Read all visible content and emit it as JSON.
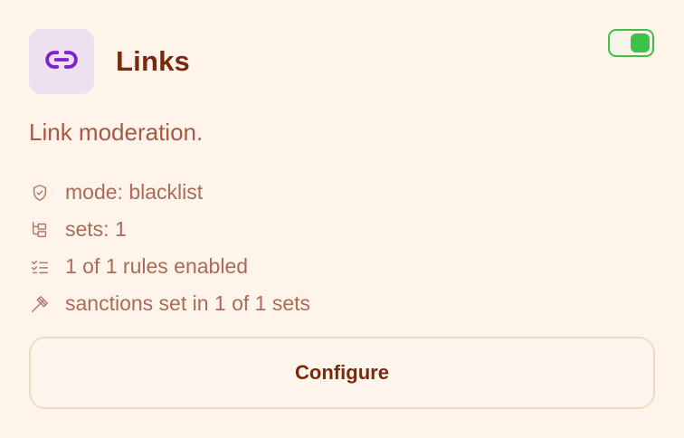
{
  "module": {
    "title": "Links",
    "description": "Link moderation.",
    "icon": "link-icon",
    "enabled": true,
    "accent_color": "#7e22ce"
  },
  "stats": [
    {
      "icon": "shield-check-icon",
      "text": "mode: blacklist"
    },
    {
      "icon": "folder-tree-icon",
      "text": "sets: 1"
    },
    {
      "icon": "list-checks-icon",
      "text": "1 of 1 rules enabled"
    },
    {
      "icon": "gavel-icon",
      "text": "sanctions set in 1 of 1 sets"
    }
  ],
  "actions": {
    "configure_label": "Configure"
  },
  "colors": {
    "toggle_on": "#3cc149",
    "title": "#7a2a0c",
    "muted_text": "#ab6b58"
  }
}
